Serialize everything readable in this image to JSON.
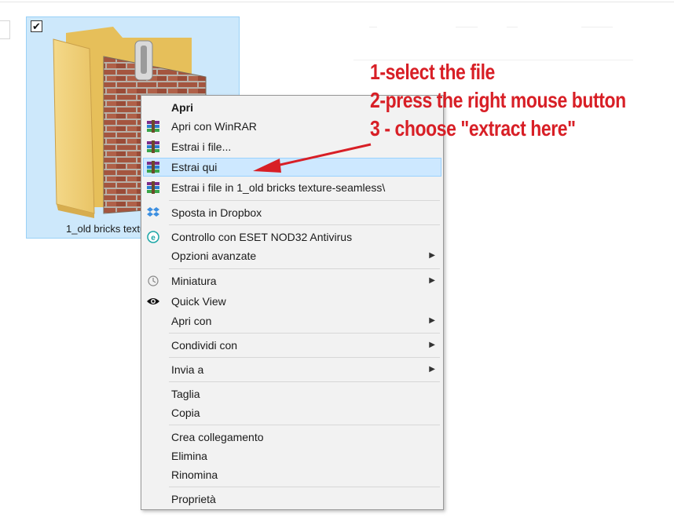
{
  "file": {
    "name": "1_old bricks texture-seamless",
    "checked": true,
    "checkmark": "✔"
  },
  "menu": {
    "items": [
      {
        "label": "Apri",
        "bold": true
      },
      {
        "label": "Apri con WinRAR",
        "icon": "winrar-icon"
      },
      {
        "label": "Estrai i file...",
        "icon": "winrar-icon"
      },
      {
        "label": "Estrai qui",
        "icon": "winrar-icon",
        "highlighted": true
      },
      {
        "label": "Estrai i file in 1_old bricks texture-seamless\\",
        "icon": "winrar-icon"
      },
      {
        "label": "Sposta in Dropbox",
        "icon": "dropbox-icon"
      },
      {
        "label": "Controllo con  ESET NOD32 Antivirus",
        "icon": "eset-icon"
      },
      {
        "label": "Opzioni avanzate",
        "submenu": true
      },
      {
        "label": "Miniatura",
        "icon": "miniatura-icon",
        "submenu": true
      },
      {
        "label": "Quick View",
        "icon": "eye-icon"
      },
      {
        "label": "Apri con",
        "submenu": true
      },
      {
        "label": "Condividi con",
        "submenu": true
      },
      {
        "label": "Invia a",
        "submenu": true
      },
      {
        "label": "Taglia"
      },
      {
        "label": "Copia"
      },
      {
        "label": "Crea collegamento"
      },
      {
        "label": "Elimina"
      },
      {
        "label": "Rinomina"
      },
      {
        "label": "Proprietà"
      }
    ],
    "submenu_arrow": "▶"
  },
  "annotation": {
    "lines": [
      "1-select the file",
      "2-press the right mouse button",
      "3 - choose \"extract here\""
    ],
    "color": "#d81f26"
  }
}
